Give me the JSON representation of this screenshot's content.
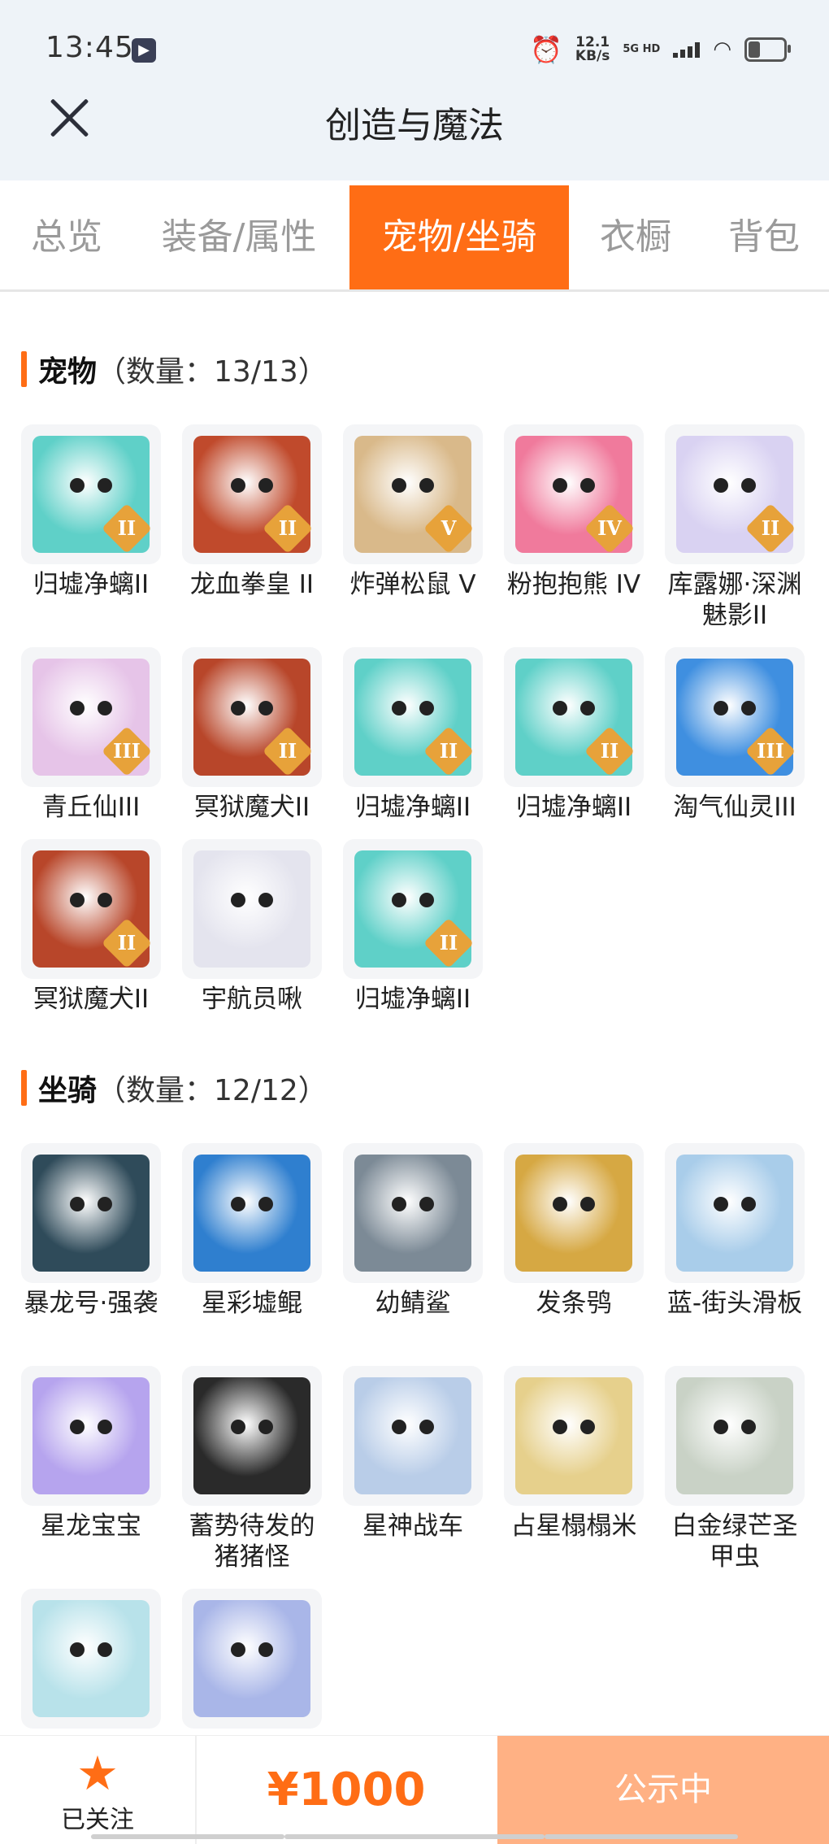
{
  "status_bar": {
    "time": "13:45",
    "net_speed_value": "12.1",
    "net_speed_unit": "KB/s",
    "network": "5G HD"
  },
  "header": {
    "title": "创造与魔法"
  },
  "tabs": [
    {
      "label": "总览",
      "active": false
    },
    {
      "label": "装备/属性",
      "active": false
    },
    {
      "label": "宠物/坐骑",
      "active": true
    },
    {
      "label": "衣橱",
      "active": false
    },
    {
      "label": "背包",
      "active": false
    }
  ],
  "pets": {
    "title": "宠物",
    "count": "（数量：13/13）",
    "items": [
      {
        "name": "归墟净螭II",
        "badge": "II",
        "color": "#5fd0c8"
      },
      {
        "name": "龙血拳皇 II",
        "badge": "II",
        "color": "#c04a2c"
      },
      {
        "name": "炸弹松鼠 V",
        "badge": "V",
        "color": "#d9b98a"
      },
      {
        "name": "粉抱抱熊 IV",
        "badge": "IV",
        "color": "#f07a9c"
      },
      {
        "name": "库露娜·深渊魅影II",
        "badge": "II",
        "color": "#d9d2f2"
      },
      {
        "name": "青丘仙III",
        "badge": "III",
        "color": "#e6c4e8"
      },
      {
        "name": "冥狱魔犬II",
        "badge": "II",
        "color": "#b8462a"
      },
      {
        "name": "归墟净螭II",
        "badge": "II",
        "color": "#5fd0c8"
      },
      {
        "name": "归墟净螭II",
        "badge": "II",
        "color": "#5fd0c8"
      },
      {
        "name": "淘气仙灵III",
        "badge": "III",
        "color": "#3f8fe0"
      },
      {
        "name": "冥狱魔犬II",
        "badge": "II",
        "color": "#b8462a"
      },
      {
        "name": "宇航员啾",
        "badge": "",
        "color": "#e4e4ee"
      },
      {
        "name": "归墟净螭II",
        "badge": "II",
        "color": "#5fd0c8"
      }
    ]
  },
  "mounts": {
    "title": "坐骑",
    "count": "（数量：12/12）",
    "items": [
      {
        "name": "暴龙号·强袭",
        "color": "#2f4b5a"
      },
      {
        "name": "星彩墟鲲",
        "color": "#2f7fcf"
      },
      {
        "name": "幼鲭鲨",
        "color": "#7c8a96"
      },
      {
        "name": "发条鸮",
        "color": "#d6a843"
      },
      {
        "name": "蓝-街头滑板",
        "color": "#a9cdea"
      },
      {
        "name": "星龙宝宝",
        "color": "#b6a4ee"
      },
      {
        "name": "蓄势待发的猪猪怪",
        "color": "#2a2a2a"
      },
      {
        "name": "星神战车",
        "color": "#b9cde8"
      },
      {
        "name": "占星榻榻米",
        "color": "#e6d08c"
      },
      {
        "name": "白金绿芒圣甲虫",
        "color": "#c9d2c6"
      },
      {
        "name": "",
        "color": "#b8e2ea"
      },
      {
        "name": "",
        "color": "#a9b6e8"
      }
    ]
  },
  "footer": {
    "follow_label": "已关注",
    "price": "¥1000",
    "status_label": "公示中"
  }
}
